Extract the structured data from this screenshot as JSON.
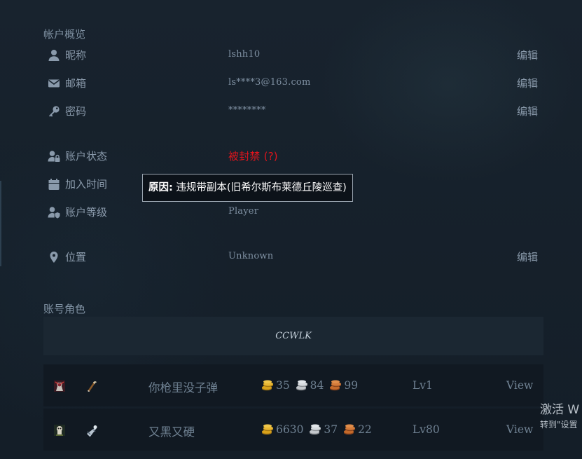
{
  "account": {
    "section_title": "帐户概览",
    "rows": [
      {
        "label": "昵称",
        "value": "lshh10",
        "edit": "编辑",
        "icon": "user-icon"
      },
      {
        "label": "邮箱",
        "value": "ls****3@163.com",
        "edit": "编辑",
        "icon": "envelope-icon"
      },
      {
        "label": "密码",
        "value": "********",
        "edit": "编辑",
        "icon": "key-icon"
      }
    ],
    "status_label": "账户状态",
    "status_value": "被封禁",
    "status_help": "(?)",
    "join_label": "加入时间",
    "level_label": "账户等级",
    "level_value": "Player",
    "location_label": "位置",
    "location_value": "Unknown",
    "location_edit": "编辑"
  },
  "tooltip": {
    "prefix": "原因:",
    "text": " 违规带副本(旧希尔斯布莱德丘陵巡查)"
  },
  "characters": {
    "section_title": "账号角色",
    "realm": "CCWLK",
    "list": [
      {
        "name": "你枪里没子弹",
        "gold": "35",
        "silver": "84",
        "copper": "99",
        "level": "Lv1",
        "view": "View",
        "race_icon": "race-icon",
        "class_icon": "class-icon"
      },
      {
        "name": "又黑又硬",
        "gold": "6630",
        "silver": "37",
        "copper": "22",
        "level": "Lv80",
        "view": "View",
        "race_icon": "race-icon",
        "class_icon": "class-icon"
      }
    ]
  },
  "watermark": {
    "line1": "激活 W",
    "line2": "转到\"设置"
  },
  "colors": {
    "background": "#16212c",
    "banned": "#e0141c",
    "gold": "#d9a21b",
    "silver": "#c4c8cc",
    "copper": "#c56a2b"
  }
}
